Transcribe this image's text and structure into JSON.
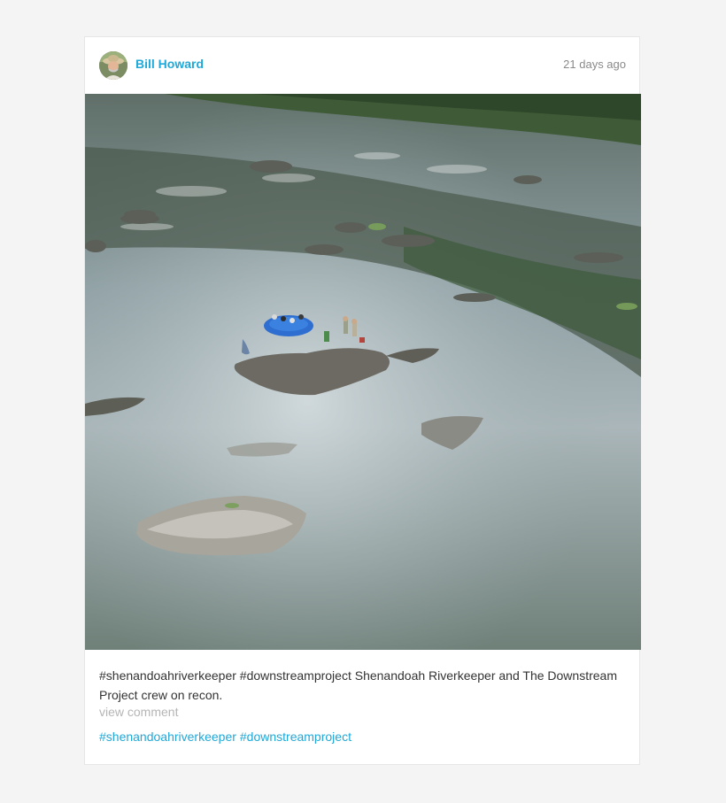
{
  "post": {
    "author": "Bill Howard",
    "timestamp": "21 days ago",
    "caption": "#shenandoahriverkeeper #downstreamproject Shenandoah Riverkeeper and The Downstream Project crew on recon.",
    "view_comment": "view comment",
    "tags": [
      "#shenandoahriverkeeper",
      "#downstreamproject"
    ]
  },
  "colors": {
    "accent": "#1fa8d8",
    "muted": "#b5b5b5",
    "timestamp": "#8a8a8a"
  },
  "icons": {
    "avatar": "user-avatar-photo"
  }
}
